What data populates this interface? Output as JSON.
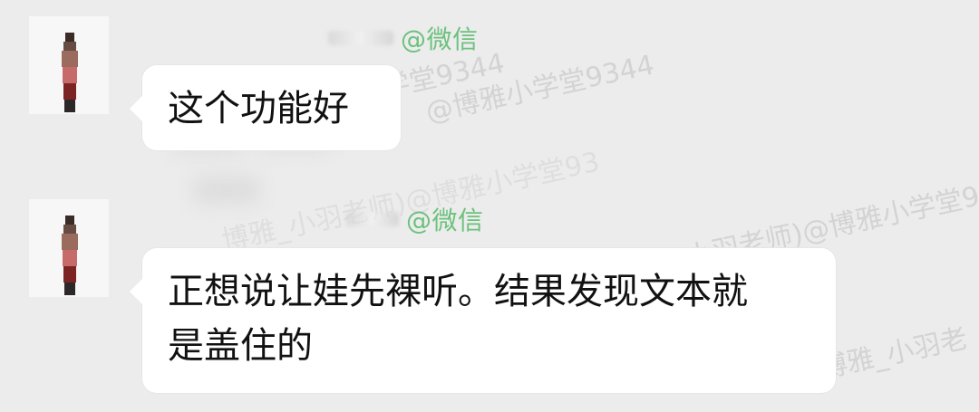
{
  "watermarks": [
    "@博雅小学堂9344",
    "@博雅小学堂9344",
    "博雅_小羽老师)@博雅小学堂93",
    "博雅_小羽老",
    "博雅_小羽老师)@博雅小学堂93"
  ],
  "messages": [
    {
      "sender_suffix": "@微信",
      "text": "这个功能好"
    },
    {
      "sender_suffix": "@微信",
      "text": "正想说让娃先裸听。结果发现文本就\n是盖住的"
    }
  ],
  "colors": {
    "background": "#ececec",
    "bubble": "#ffffff",
    "accent": "#6cc17d",
    "text": "#111111"
  }
}
